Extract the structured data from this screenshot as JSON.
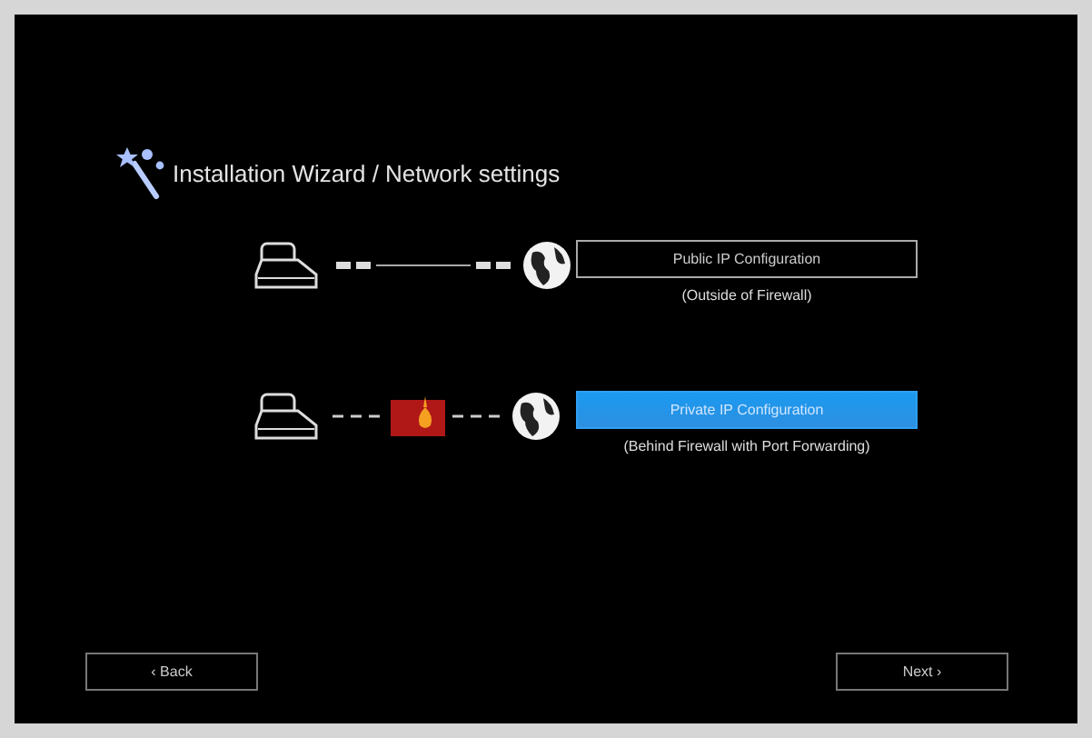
{
  "title": "Installation Wizard / Network settings",
  "options": [
    {
      "kind": "direct",
      "label": "Public IP Configuration",
      "caption": "(Outside of Firewall)",
      "selected": false
    },
    {
      "kind": "firewall",
      "label": "Private IP Configuration",
      "caption": "(Behind Firewall with Port Forwarding)",
      "selected": true
    }
  ],
  "buttons": {
    "back": "‹ Back",
    "next": "Next ›"
  }
}
